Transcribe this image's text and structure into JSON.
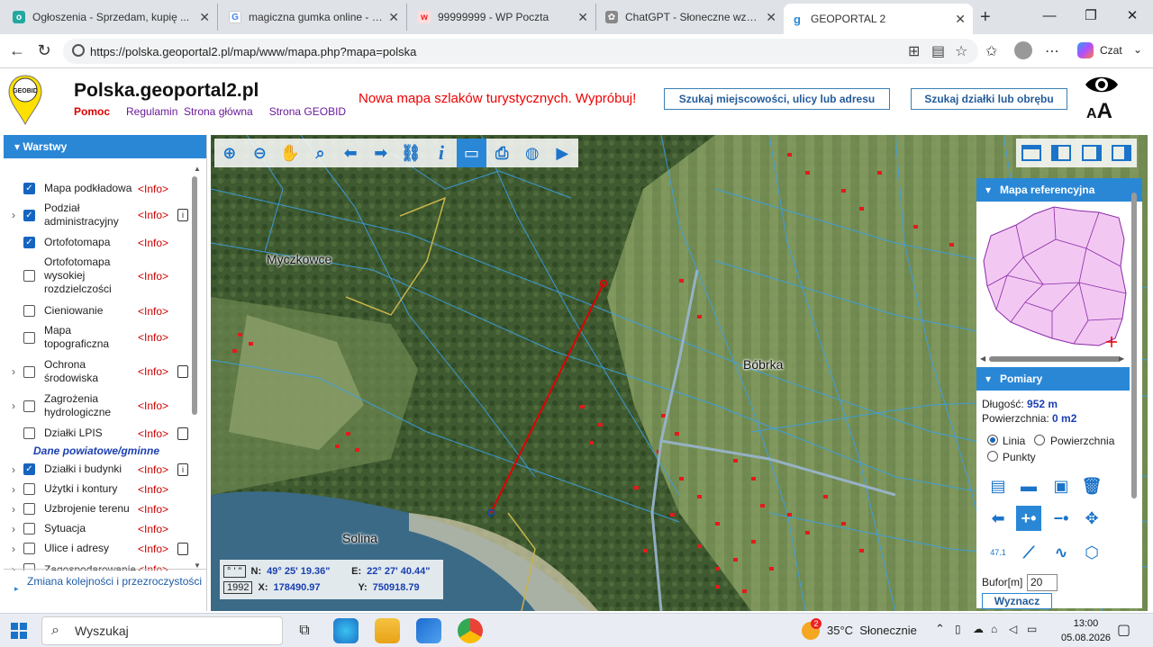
{
  "browser": {
    "tabs": [
      {
        "title": "Ogłoszenia - Sprzedam, kupię ...",
        "icon": "olx-icon",
        "color": "#23a8a0"
      },
      {
        "title": "magiczna gumka online - Szuk...",
        "icon": "google-icon",
        "color": "#4285f4"
      },
      {
        "title": "99999999 - WP Poczta",
        "icon": "wp-icon",
        "color": "#e22"
      },
      {
        "title": "ChatGPT - Słoneczne wzgórze ...",
        "icon": "chatgpt-icon",
        "color": "#555"
      },
      {
        "title": "GEOPORTAL 2",
        "icon": "geoportal-icon",
        "color": "#2a87d6"
      }
    ],
    "url": "https://polska.geoportal2.pl/map/www/mapa.php?mapa=polska",
    "profile_label": "Czat"
  },
  "header": {
    "logo_text": "GEOBID",
    "site_title": "Polska.geoportal2.pl",
    "links": [
      "Pomoc",
      "Regulamin",
      "Strona główna",
      "Strona GEOBID"
    ],
    "promo": "Nowa mapa szlaków turystycznych. Wypróbuj!",
    "search_place_btn": "Szukaj miejscowości, ulicy lub adresu",
    "search_plot_btn": "Szukaj działki lub obrębu",
    "font_size_toggle": "AA"
  },
  "layers": {
    "title": "Warstwy",
    "info_label": "<Info>",
    "items": [
      {
        "name": "Mapa podkładowa",
        "checked": true,
        "expand": false,
        "doc": false
      },
      {
        "name": "Podział administracyjny",
        "checked": true,
        "expand": true,
        "doc": "info"
      },
      {
        "name": "Ortofotomapa",
        "checked": true,
        "expand": false,
        "doc": false
      },
      {
        "name": "Ortofotomapa wysokiej rozdzielczości",
        "checked": false,
        "expand": false,
        "doc": false
      },
      {
        "name": "Cieniowanie",
        "checked": false,
        "expand": false,
        "doc": false
      },
      {
        "name": "Mapa topograficzna",
        "checked": false,
        "expand": false,
        "doc": false
      },
      {
        "name": "Ochrona środowiska",
        "checked": false,
        "expand": true,
        "doc": "page"
      },
      {
        "name": "Zagrożenia hydrologiczne",
        "checked": false,
        "expand": true,
        "doc": false
      },
      {
        "name": "Działki LPIS",
        "checked": false,
        "expand": false,
        "doc": "page"
      },
      {
        "name": "Działki i budynki",
        "checked": true,
        "expand": true,
        "doc": "info"
      },
      {
        "name": "Użytki i kontury",
        "checked": false,
        "expand": true,
        "doc": false
      },
      {
        "name": "Uzbrojenie terenu",
        "checked": false,
        "expand": true,
        "doc": false
      },
      {
        "name": "Sytuacja",
        "checked": false,
        "expand": true,
        "doc": false
      },
      {
        "name": "Ulice i adresy",
        "checked": false,
        "expand": true,
        "doc": "page"
      },
      {
        "name": "Zagospodarowanie",
        "checked": false,
        "expand": true,
        "doc": false
      }
    ],
    "section_label": "Dane powiatowe/gminne",
    "order_label": "Zmiana kolejności i przezroczystości"
  },
  "map": {
    "places": [
      "Myczkowce",
      "Bóbrka",
      "Solina"
    ],
    "coords": {
      "unit1": "° ' \"",
      "unit2": "1992",
      "n_label": "N:",
      "n_value": "49° 25' 19.36\"",
      "e_label": "E:",
      "e_value": "22° 27' 40.44\"",
      "x_label": "X:",
      "x_value": "178490.97",
      "y_label": "Y:",
      "y_value": "750918.79"
    }
  },
  "refmap": {
    "title": "Mapa referencyjna"
  },
  "pomiary": {
    "title": "Pomiary",
    "length_label": "Długość:",
    "length_value": "952 m",
    "area_label": "Powierzchnia:",
    "area_value": "0 m2",
    "mode_lines": "Linia",
    "mode_area": "Powierzchnia",
    "mode_points": "Punkty",
    "selected_mode": "Linia",
    "bufor_label": "Bufor[m]",
    "bufor_value": "20",
    "submit": "Wyznacz",
    "tool_label_471": "47.1"
  },
  "taskbar": {
    "search_placeholder": "Wyszukaj",
    "weather_badge": "2",
    "weather": "35°C  Słonecznie",
    "time": "13:00",
    "date": "05.08.2026"
  },
  "colors": {
    "accent": "#2a87d6",
    "info_red": "#cc0000",
    "link_purple": "#6a1a9a",
    "measure_line": "#e00000"
  }
}
